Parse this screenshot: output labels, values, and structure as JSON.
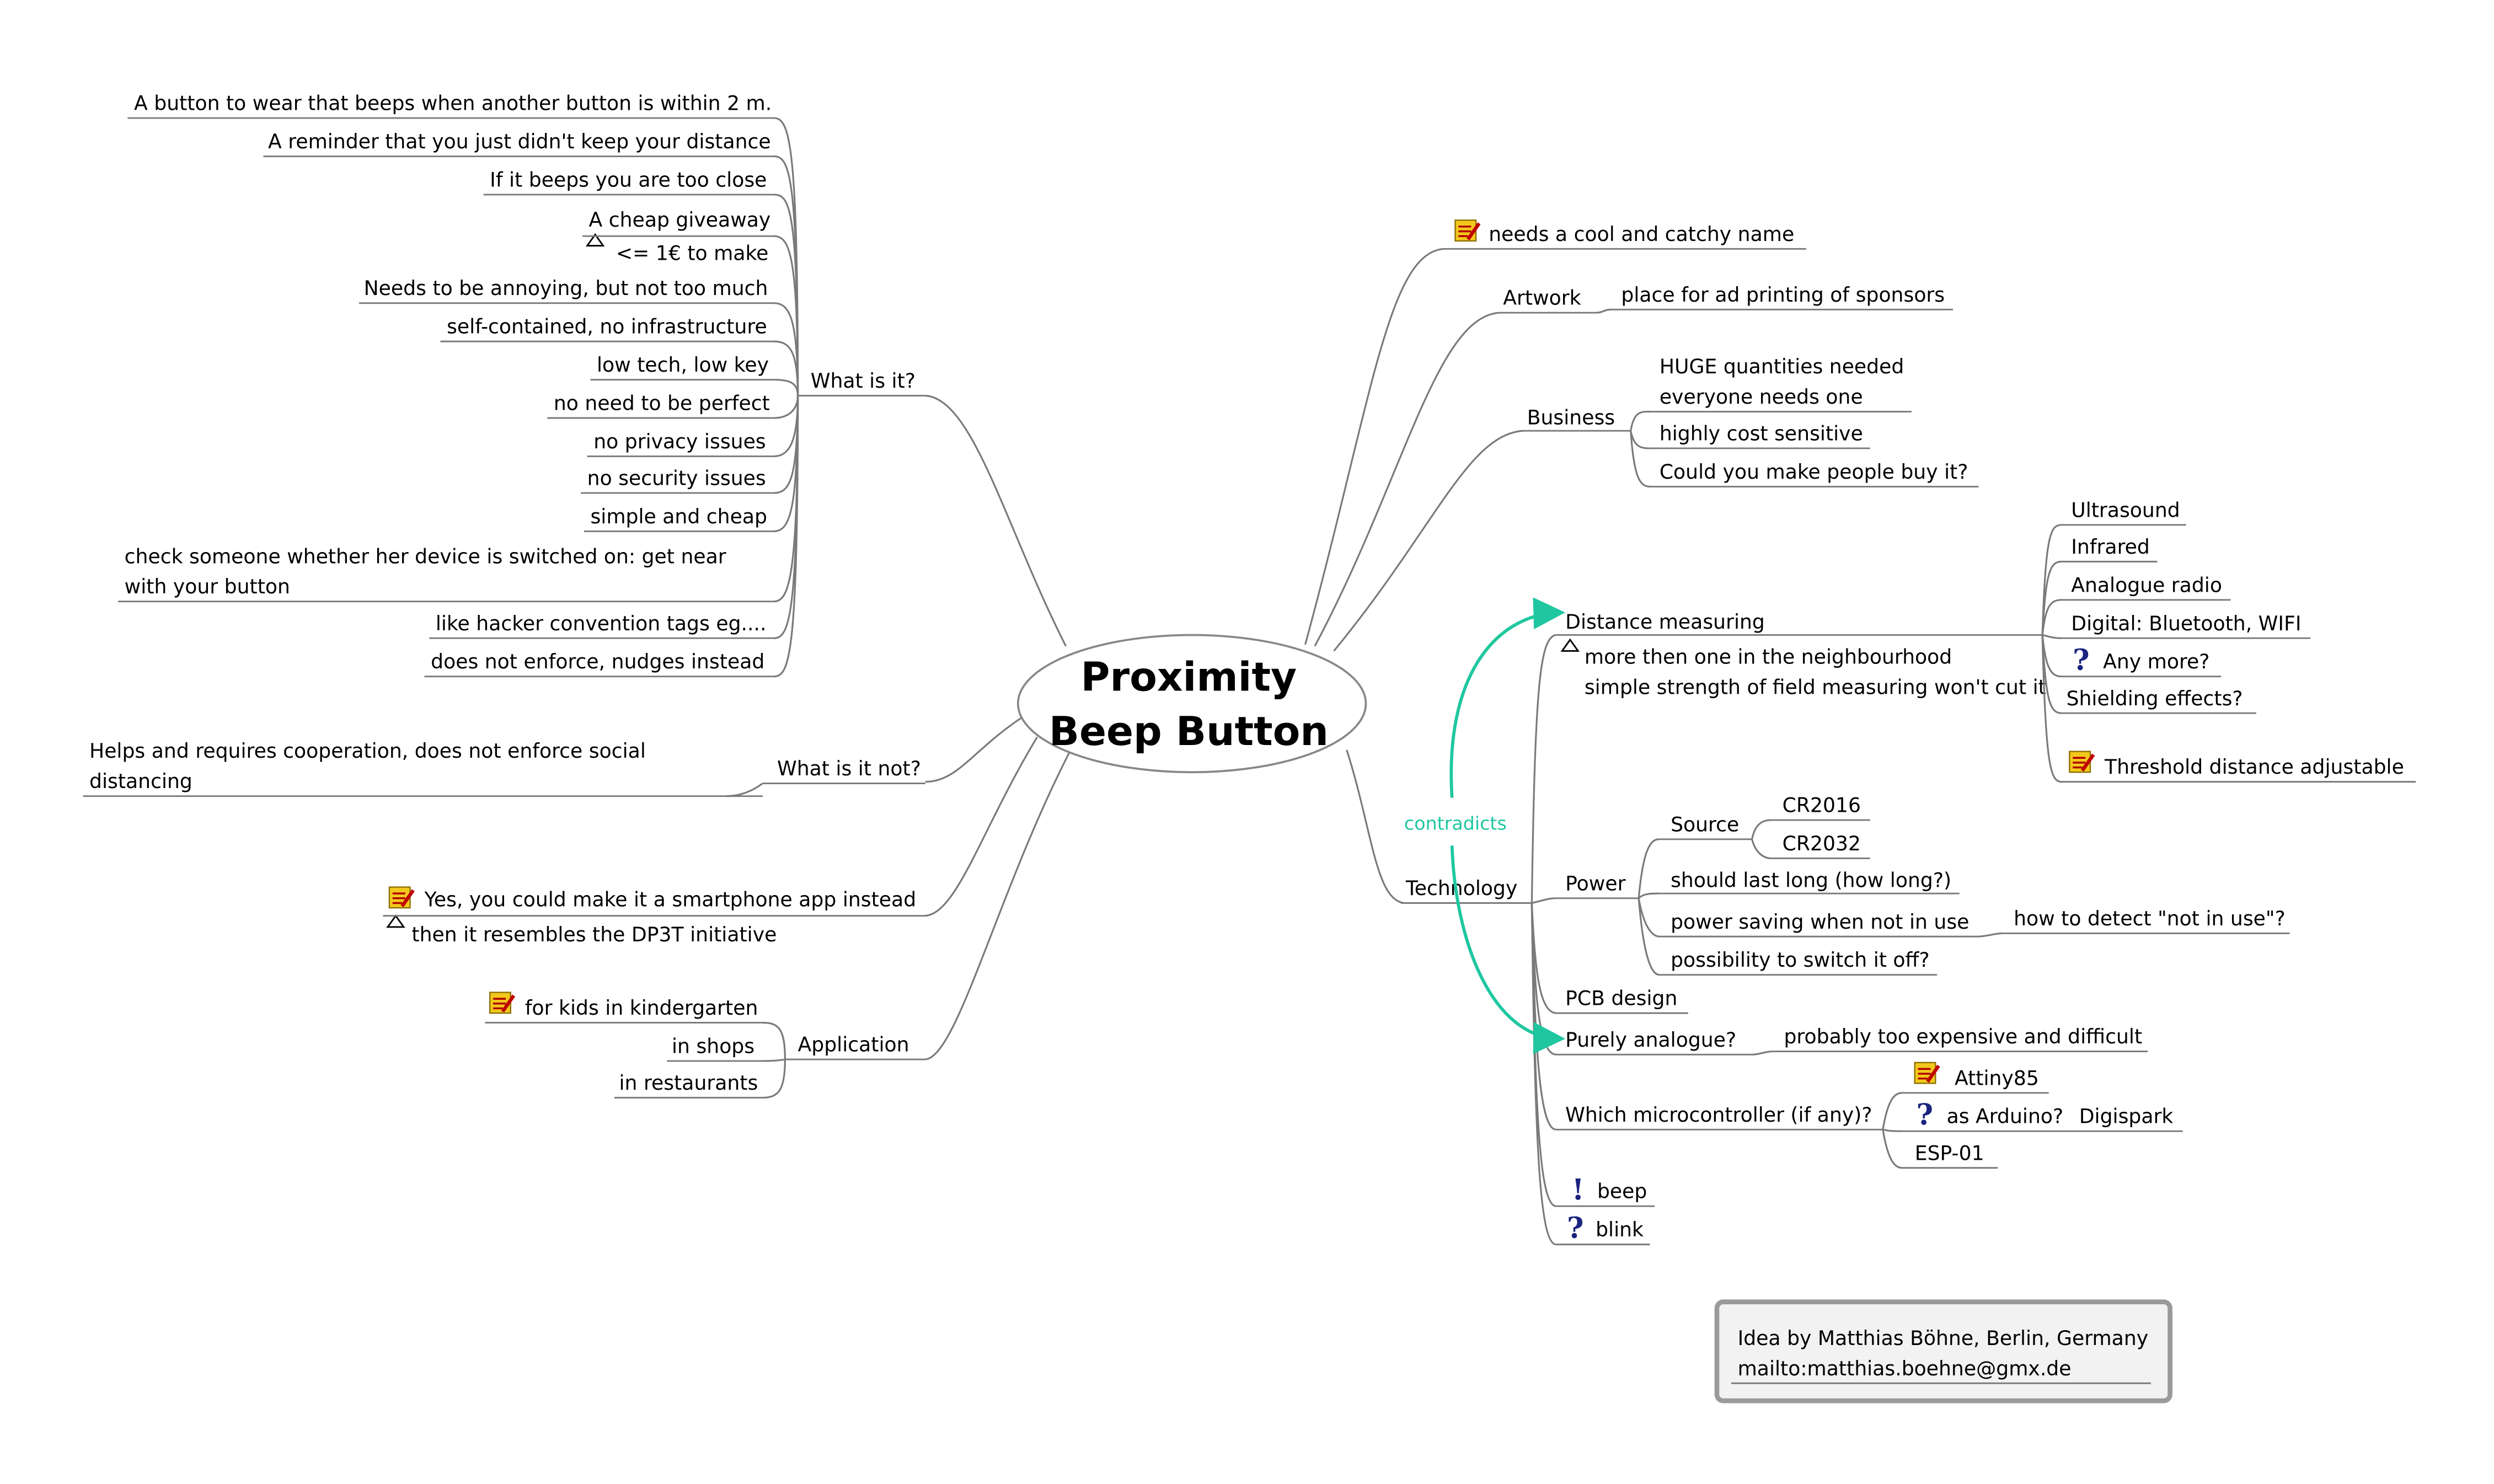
{
  "root": {
    "line1": "Proximity",
    "line2": "Beep Button"
  },
  "left": {
    "what_is_it": {
      "label": "What is it?",
      "items": [
        "A button to wear that beeps when another button is within 2 m.",
        "A reminder that you just didn't keep your distance",
        "If it beeps you are too close",
        "A cheap giveaway",
        "<= 1€ to make",
        "Needs to be annoying, but not too much",
        "self-contained, no infrastructure",
        "low tech, low key",
        "no need to be perfect",
        "no privacy issues",
        "no security issues",
        "simple and cheap",
        "check someone whether her device is switched on: get near",
        "with your button",
        "like hacker convention tags eg....",
        "does not enforce, nudges instead"
      ]
    },
    "what_is_it_not": {
      "label": "What is it not?",
      "items": [
        "Helps and requires cooperation, does not enforce social",
        "distancing"
      ]
    },
    "smartphone": {
      "line1": "Yes, you could make it a smartphone app instead",
      "line2": "then it resembles the DP3T initiative"
    },
    "application": {
      "label": "Application",
      "items": [
        "for kids in kindergarten",
        "in shops",
        "in restaurants"
      ]
    }
  },
  "right": {
    "name_note": "needs a cool and catchy name",
    "artwork": {
      "label": "Artwork",
      "item": "place for ad printing of sponsors"
    },
    "business": {
      "label": "Business",
      "items": [
        "HUGE quantities needed",
        "everyone needs one",
        "highly cost sensitive",
        "Could you make people buy it?"
      ]
    },
    "technology": {
      "label": "Technology",
      "distance": {
        "label": "Distance measuring",
        "note1": "more then one in the neighbourhood",
        "note2": "simple strength of field measuring won't cut it",
        "items": [
          "Ultrasound",
          "Infrared",
          "Analogue radio",
          "Digital: Bluetooth, WIFI",
          "Any more?",
          "Shielding effects?",
          "Threshold distance adjustable"
        ]
      },
      "power": {
        "label": "Power",
        "source": {
          "label": "Source",
          "items": [
            "CR2016",
            "CR2032"
          ]
        },
        "items": [
          "should last long (how long?)",
          "power saving when not in use",
          "possibility to switch it off?"
        ],
        "detect": "how to detect \"not in use\"?"
      },
      "pcb": "PCB design",
      "analogue": {
        "label": "Purely analogue?",
        "item": "probably too expensive and difficult"
      },
      "micro": {
        "label": "Which microcontroller (if any)?",
        "items": [
          "Attiny85",
          "as Arduino?",
          "Digispark",
          "ESP-01"
        ]
      },
      "beep": "beep",
      "blink": "blink"
    }
  },
  "relation": "contradicts",
  "credit": {
    "line1": "Idea by Matthias Böhne, Berlin, Germany",
    "line2": "mailto:matthias.boehne@gmx.de"
  },
  "colors": {
    "relation": "#1fc7a0",
    "question": "#1a237e",
    "connector": "#7a7a7a",
    "note_icon": "#f2c81c"
  }
}
